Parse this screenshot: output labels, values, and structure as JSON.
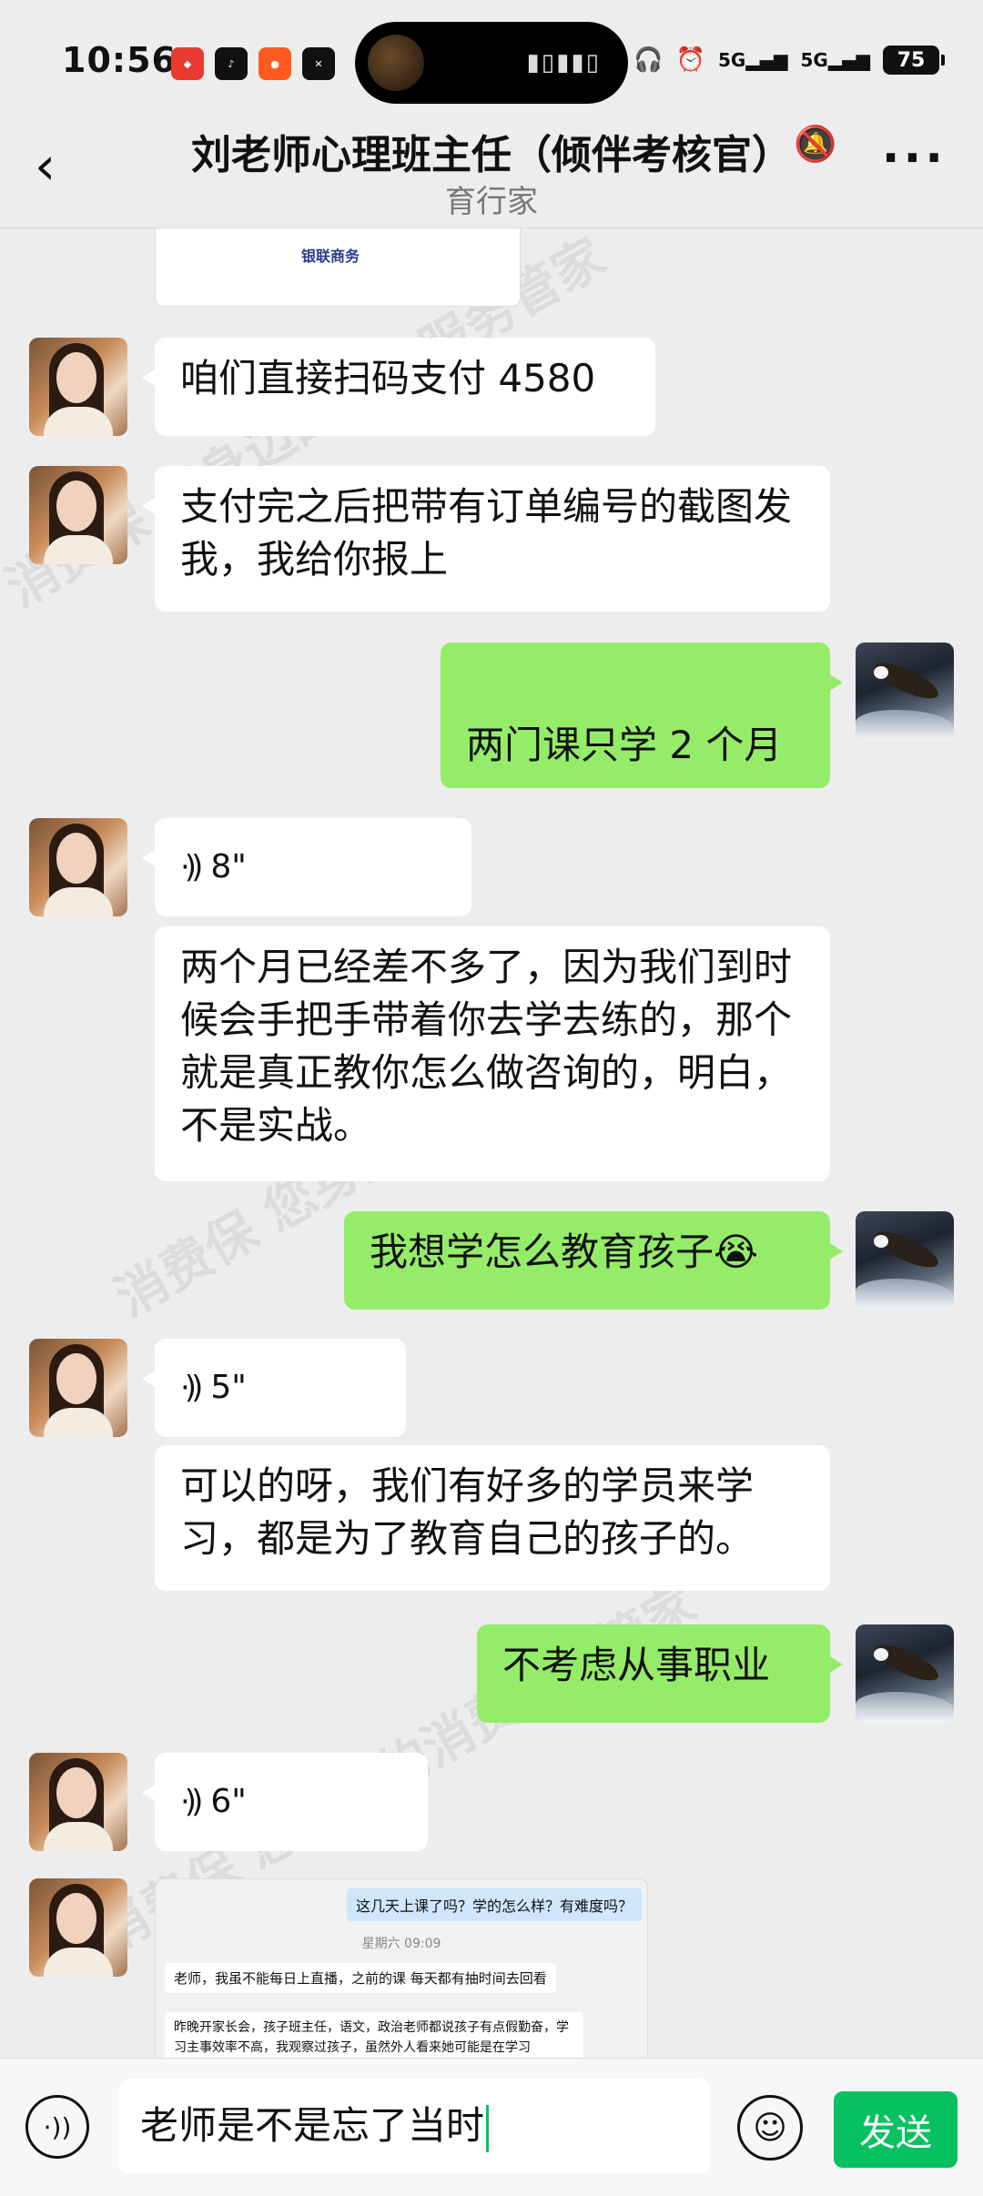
{
  "status_bar": {
    "time": "10:56",
    "app_icons": [
      "app-icon-1",
      "tiktok-icon",
      "app-icon-3",
      "capcut-icon"
    ],
    "signal_1": "5G",
    "signal_2": "5G",
    "battery": "75"
  },
  "header": {
    "title": "刘老师心理班主任（倾伴考核官）",
    "subtitle": "育行家"
  },
  "messages": {
    "card_logo": "银联商务",
    "m1": "咱们直接扫码支付 4580",
    "m2": "支付完之后把带有订单编号的截图发我，我给你报上",
    "m3": "两门课只学 2 个月",
    "v1": "8\"",
    "m4": "两个月已经差不多了，因为我们到时候会手把手带着你去学去练的，那个就是真正教你怎么做咨询的，明白，不是实战。",
    "m5": "我想学怎么教育孩子😭",
    "v2": "5\"",
    "m6": "可以的呀，我们有好多的学员来学习，都是为了教育自己的孩子的。",
    "m7": "不考虑从事职业",
    "v3": "6\""
  },
  "screenshot": {
    "question": "这几天上课了吗？学的怎么样？有难度吗？",
    "timestamp": "星期六 09:09",
    "reply1": "老师，我虽不能每日上直播，之前的课 每天都有抽时间去回看",
    "reply2": "昨晚开家长会，孩子班主任，语文，政治老师都说孩子有点假勤奋，学习主事效率不高，我观察过孩子，虽然外人看来她可能是在学习"
  },
  "input": {
    "text": "老师是不是忘了当时",
    "send": "发送"
  },
  "watermark": "消费保 您身边的消费服务管家",
  "colors": {
    "background": "#ededed",
    "bubble_out": "#95ec69",
    "bubble_in": "#ffffff",
    "send_button": "#07c160"
  }
}
